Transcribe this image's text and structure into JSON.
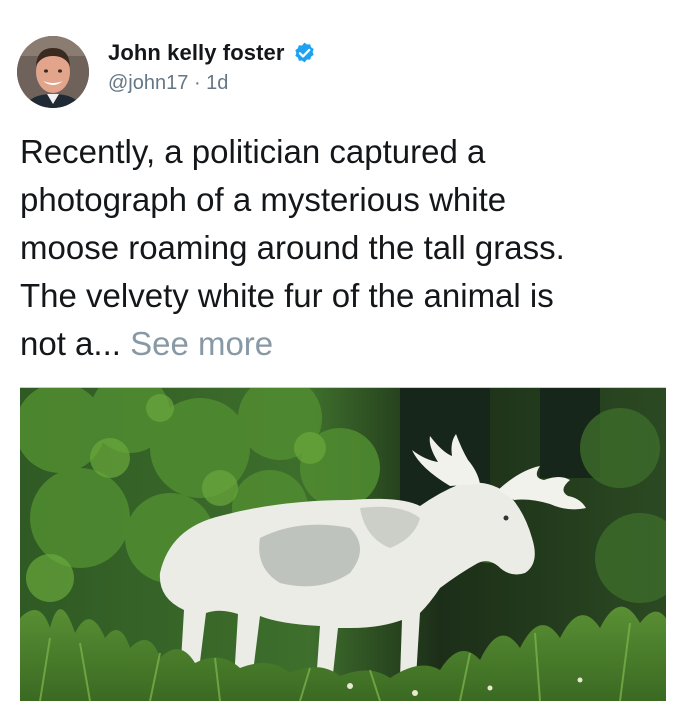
{
  "tweet": {
    "author": {
      "display_name": "John kelly foster",
      "handle": "@john17",
      "separator": "·",
      "time_ago": "1d",
      "verified_icon": "verified-badge-icon",
      "badge_color": "#1da1f2"
    },
    "text": {
      "lines": [
        "Recently, a politician captured a",
        "photograph of a mysterious white",
        "moose roaming around the tall grass.",
        "The velvety white fur of the animal is"
      ],
      "last_line_prefix": "not a...",
      "see_more": "See more"
    },
    "media": {
      "type": "photo",
      "subject": "white-moose"
    }
  },
  "colors": {
    "text_primary": "#14171a",
    "text_secondary": "#657786",
    "link_muted": "#8899a6"
  }
}
